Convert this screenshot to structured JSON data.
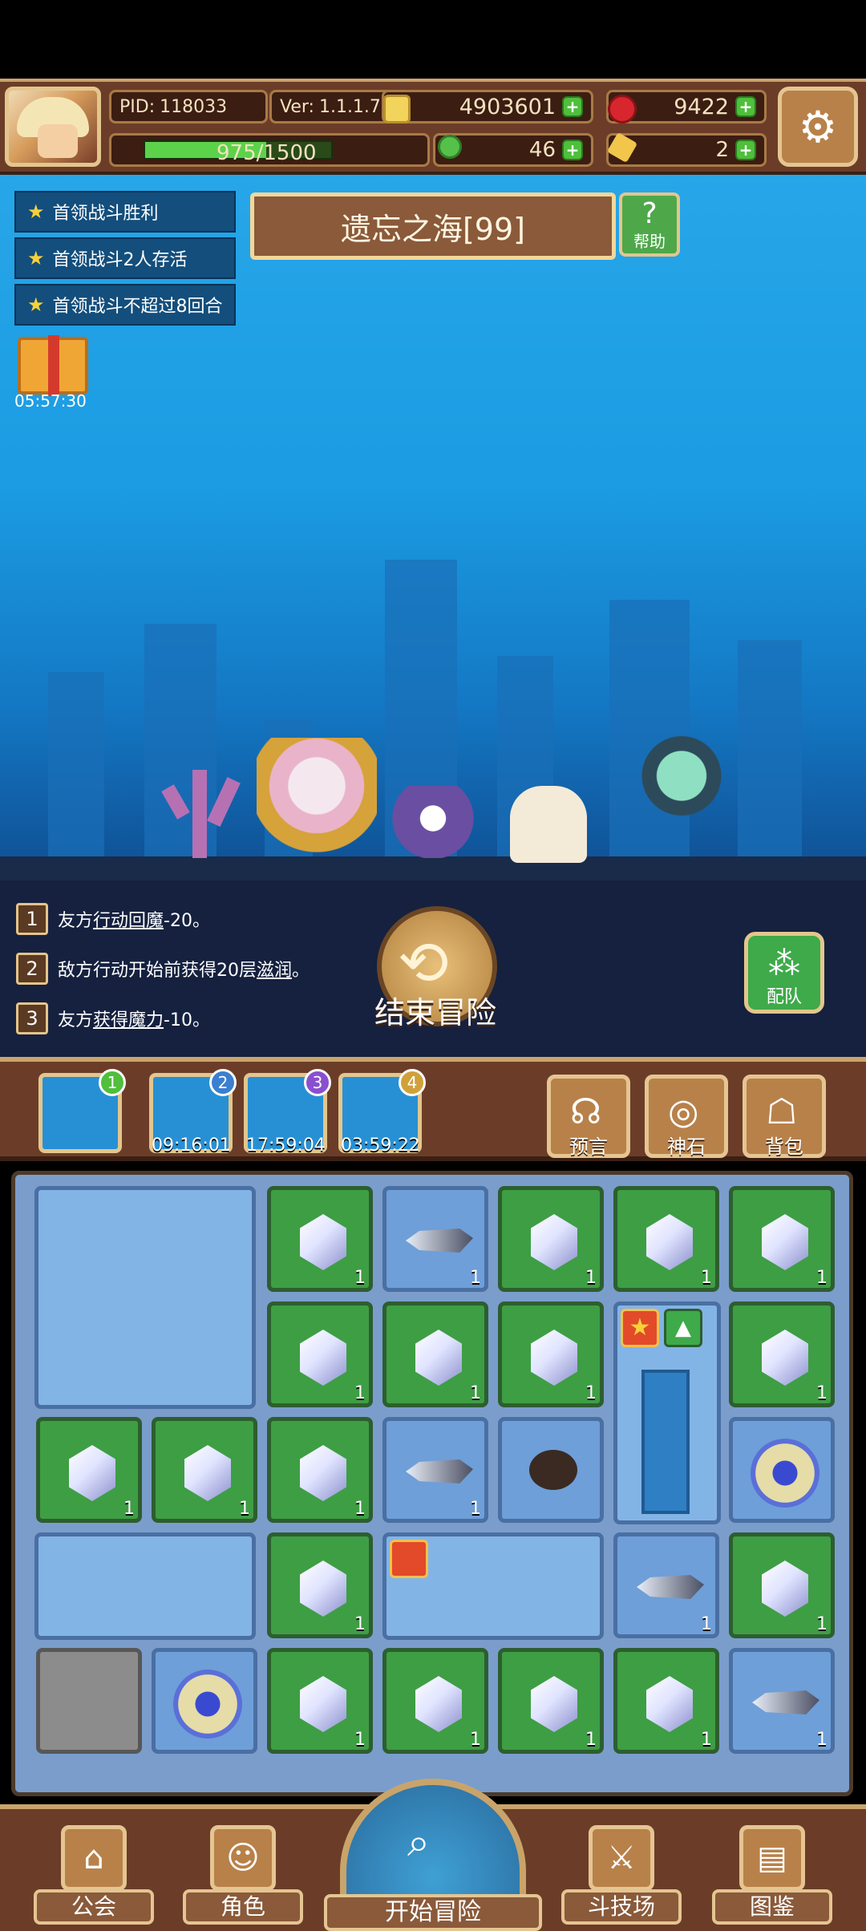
{
  "header": {
    "pid_label": "PID:",
    "pid": "118033",
    "ver_label": "Ver:",
    "version": "1.1.1.7",
    "gold": "4903601",
    "gems": "9422",
    "hp_text": "975/1500",
    "hp_fraction": 0.65,
    "clover": "46",
    "keys": "2"
  },
  "objectives": [
    "首领战斗胜利",
    "首领战斗2人存活",
    "首领战斗不超过8回合"
  ],
  "gift_timer": "05:57:30",
  "stage_title": "遗忘之海[99]",
  "help_label": "帮助",
  "effects": [
    {
      "num": "1",
      "pre": "友方",
      "u": "行动回魔",
      "post": "-20。"
    },
    {
      "num": "2",
      "pre": "敌方行动开始前获得20层",
      "u": "滋润",
      "post": "。"
    },
    {
      "num": "3",
      "pre": "友方",
      "u": "获得魔力",
      "post": "-10。"
    }
  ],
  "end_adventure_label": "结束冒险",
  "team_label": "配队",
  "slots": [
    {
      "num": "1",
      "time": ""
    },
    {
      "num": "2",
      "time": "09:16:01"
    },
    {
      "num": "3",
      "time": "17:59:04"
    },
    {
      "num": "4",
      "time": "03:59:22"
    }
  ],
  "side_buttons": {
    "prophecy": "预言",
    "god_stone": "神石",
    "backpack": "背包"
  },
  "inventory_qty": "1",
  "nav": {
    "guild": "公会",
    "character": "角色",
    "start": "开始冒险",
    "arena": "斗技场",
    "codex": "图鉴"
  },
  "colors": {
    "frame_brown": "#6b3d28",
    "gold_trim": "#e3c68c",
    "sky_blue": "#1b9be2",
    "tile_green": "#3e9e44",
    "tile_blue": "#6e9fd8"
  },
  "icons": [
    "settings-gear-icon",
    "help-question-icon",
    "gift-box-icon",
    "team-icon",
    "prophecy-icon",
    "god-stone-icon",
    "backpack-icon",
    "guild-icon",
    "character-icon",
    "magnifier-icon",
    "arena-swords-icon",
    "codex-book-icon"
  ]
}
